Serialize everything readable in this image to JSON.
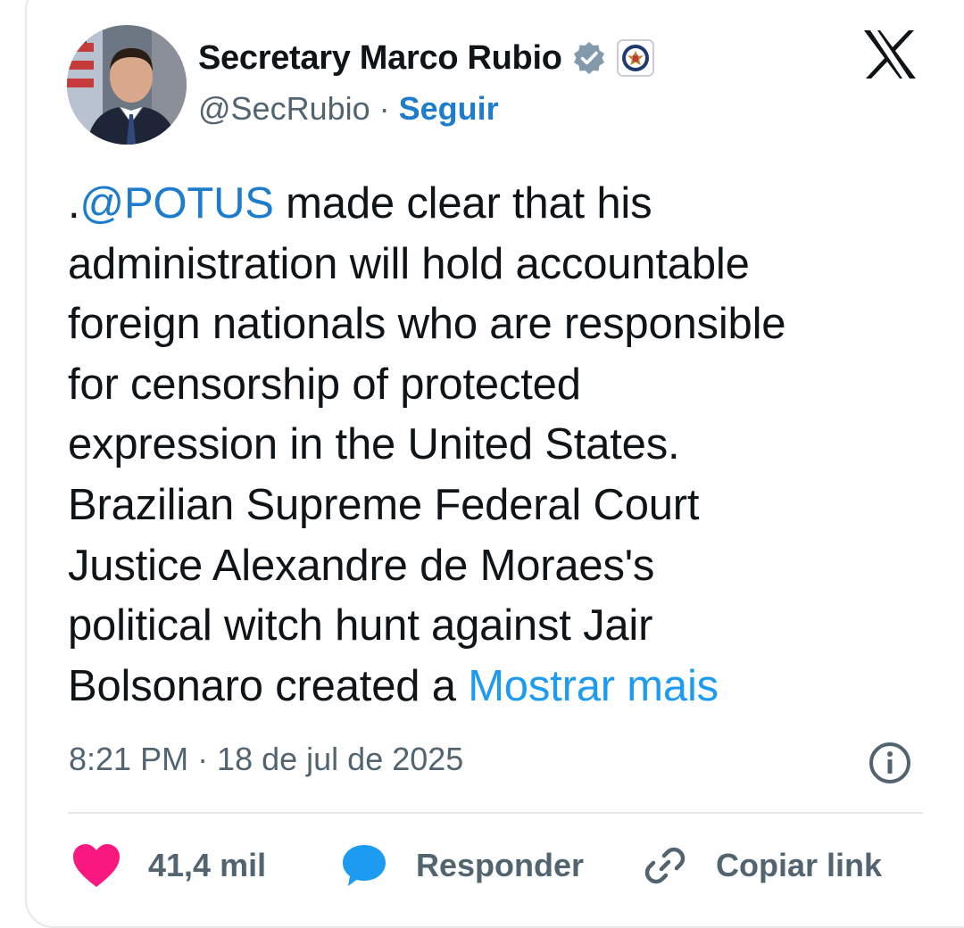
{
  "author": {
    "name": "Secretary Marco Rubio",
    "handle": "@SecRubio",
    "separator": "·",
    "follow_label": "Seguir"
  },
  "platform_icon": "x-logo-icon",
  "tweet": {
    "lines": [
      {
        "prefix": ".",
        "mention": "@POTUS",
        "text": " made clear that his"
      },
      {
        "text": "administration will hold accountable"
      },
      {
        "text": "foreign nationals who are responsible"
      },
      {
        "text": "for censorship of protected"
      },
      {
        "text": "expression in the United States."
      },
      {
        "text": "Brazilian Supreme Federal Court"
      },
      {
        "text": "Justice Alexandre de Moraes's"
      },
      {
        "text": "political witch hunt against Jair"
      },
      {
        "text": "Bolsonaro created a ",
        "more": "Mostrar mais"
      }
    ]
  },
  "timestamp": "8:21 PM · 18 de jul de 2025",
  "actions": {
    "like_count": "41,4 mil",
    "reply_label": "Responder",
    "copy_link_label": "Copiar link"
  },
  "colors": {
    "link": "#1d7ccc",
    "like": "#f91880",
    "reply": "#1d9bf0",
    "muted": "#536471"
  }
}
